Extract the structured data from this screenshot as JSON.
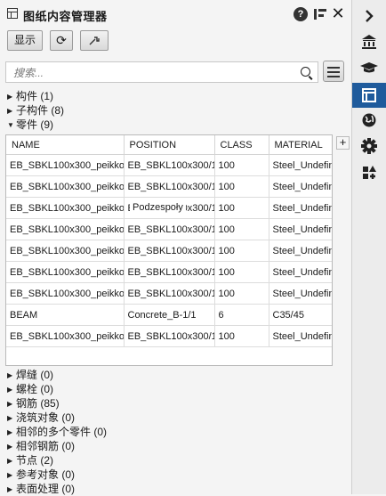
{
  "header": {
    "title": "图纸内容管理器"
  },
  "toolbar": {
    "show_label": "显示"
  },
  "search": {
    "placeholder": "搜索..."
  },
  "tree_top": [
    {
      "label": "构件 (1)",
      "expanded": false
    },
    {
      "label": "子构件 (8)",
      "expanded": false
    },
    {
      "label": "零件 (9)",
      "expanded": true
    }
  ],
  "table": {
    "columns": [
      "NAME",
      "POSITION",
      "CLASS",
      "MATERIAL"
    ],
    "rows": [
      [
        "EB_SBKL100x300_peikko",
        "EB_SBKL100x300/1",
        "100",
        "Steel_Undefined"
      ],
      [
        "EB_SBKL100x300_peikko",
        "EB_SBKL100x300/1",
        "100",
        "Steel_Undefined"
      ],
      [
        "EB_SBKL100x300_peikko",
        "EB_SBKL100x300/1",
        "100",
        "Steel_Undefined"
      ],
      [
        "EB_SBKL100x300_peikko",
        "EB_SBKL100x300/1",
        "100",
        "Steel_Undefined"
      ],
      [
        "EB_SBKL100x300_peikko",
        "EB_SBKL100x300/1",
        "100",
        "Steel_Undefined"
      ],
      [
        "EB_SBKL100x300_peikko",
        "EB_SBKL100x300/1",
        "100",
        "Steel_Undefined"
      ],
      [
        "EB_SBKL100x300_peikko",
        "EB_SBKL100x300/1",
        "100",
        "Steel_Undefined"
      ],
      [
        "BEAM",
        "Concrete_B-1/1",
        "6",
        "C35/45"
      ],
      [
        "EB_SBKL100x300_peikko",
        "EB_SBKL100x300/1",
        "100",
        "Steel_Undefined"
      ]
    ],
    "tooltip": "Podzespoły",
    "scroll_fraction": 0.68
  },
  "tree_bottom": [
    {
      "label": "焊缝 (0)"
    },
    {
      "label": "螺栓 (0)"
    },
    {
      "label": "钢筋 (85)"
    },
    {
      "label": "浇筑对象 (0)"
    },
    {
      "label": "相邻的多个零件 (0)"
    },
    {
      "label": "相邻钢筋 (0)"
    },
    {
      "label": "节点 (2)"
    },
    {
      "label": "参考对象 (0)"
    },
    {
      "label": "表面处理 (0)"
    }
  ],
  "right_bar": {
    "icons": [
      "chevron-right-icon",
      "bank-icon",
      "graduation-cap-icon",
      "layout-panel-icon",
      "globe-icon",
      "gear-icon",
      "shapes-icon"
    ],
    "active": "layout-panel-icon"
  }
}
